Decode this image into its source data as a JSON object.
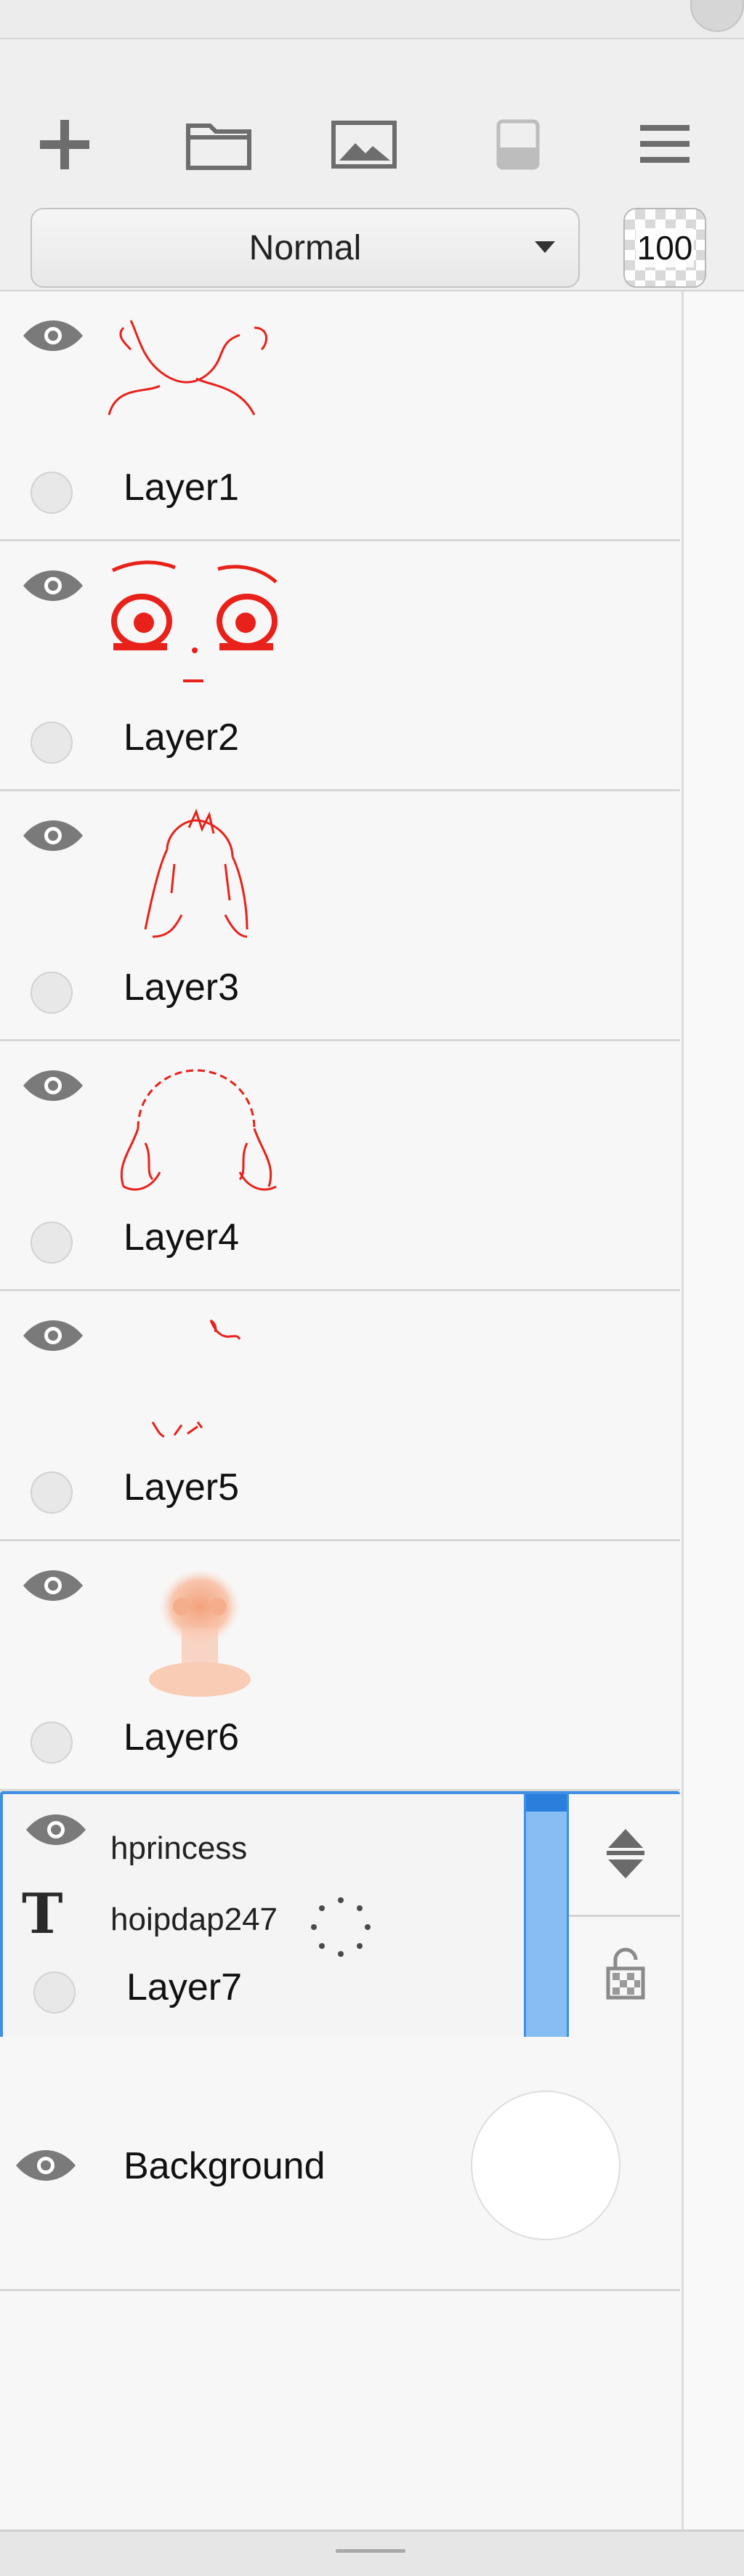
{
  "toolbar": {
    "icons": [
      "add-layer-icon",
      "folder-icon",
      "image-icon",
      "layer-mask-icon",
      "menu-icon"
    ],
    "blend_mode": "Normal",
    "opacity": "100"
  },
  "layers": [
    {
      "name": "Layer1",
      "visible": true,
      "thumb": "neck-lines"
    },
    {
      "name": "Layer2",
      "visible": true,
      "thumb": "eyes"
    },
    {
      "name": "Layer3",
      "visible": true,
      "thumb": "hair-front"
    },
    {
      "name": "Layer4",
      "visible": true,
      "thumb": "hair-back"
    },
    {
      "name": "Layer5",
      "visible": true,
      "thumb": "small-strokes"
    },
    {
      "name": "Layer6",
      "visible": true,
      "thumb": "face-color"
    },
    {
      "name": "Layer7",
      "visible": true,
      "selected": true,
      "text_layer": true,
      "text_lines": [
        "hprincess",
        "hoipdap247"
      ]
    },
    {
      "name": "Background",
      "visible": true,
      "fill": "#ffffff"
    }
  ],
  "colors": {
    "accent": "#3f8fe6",
    "stroke_red": "#e8211a"
  }
}
